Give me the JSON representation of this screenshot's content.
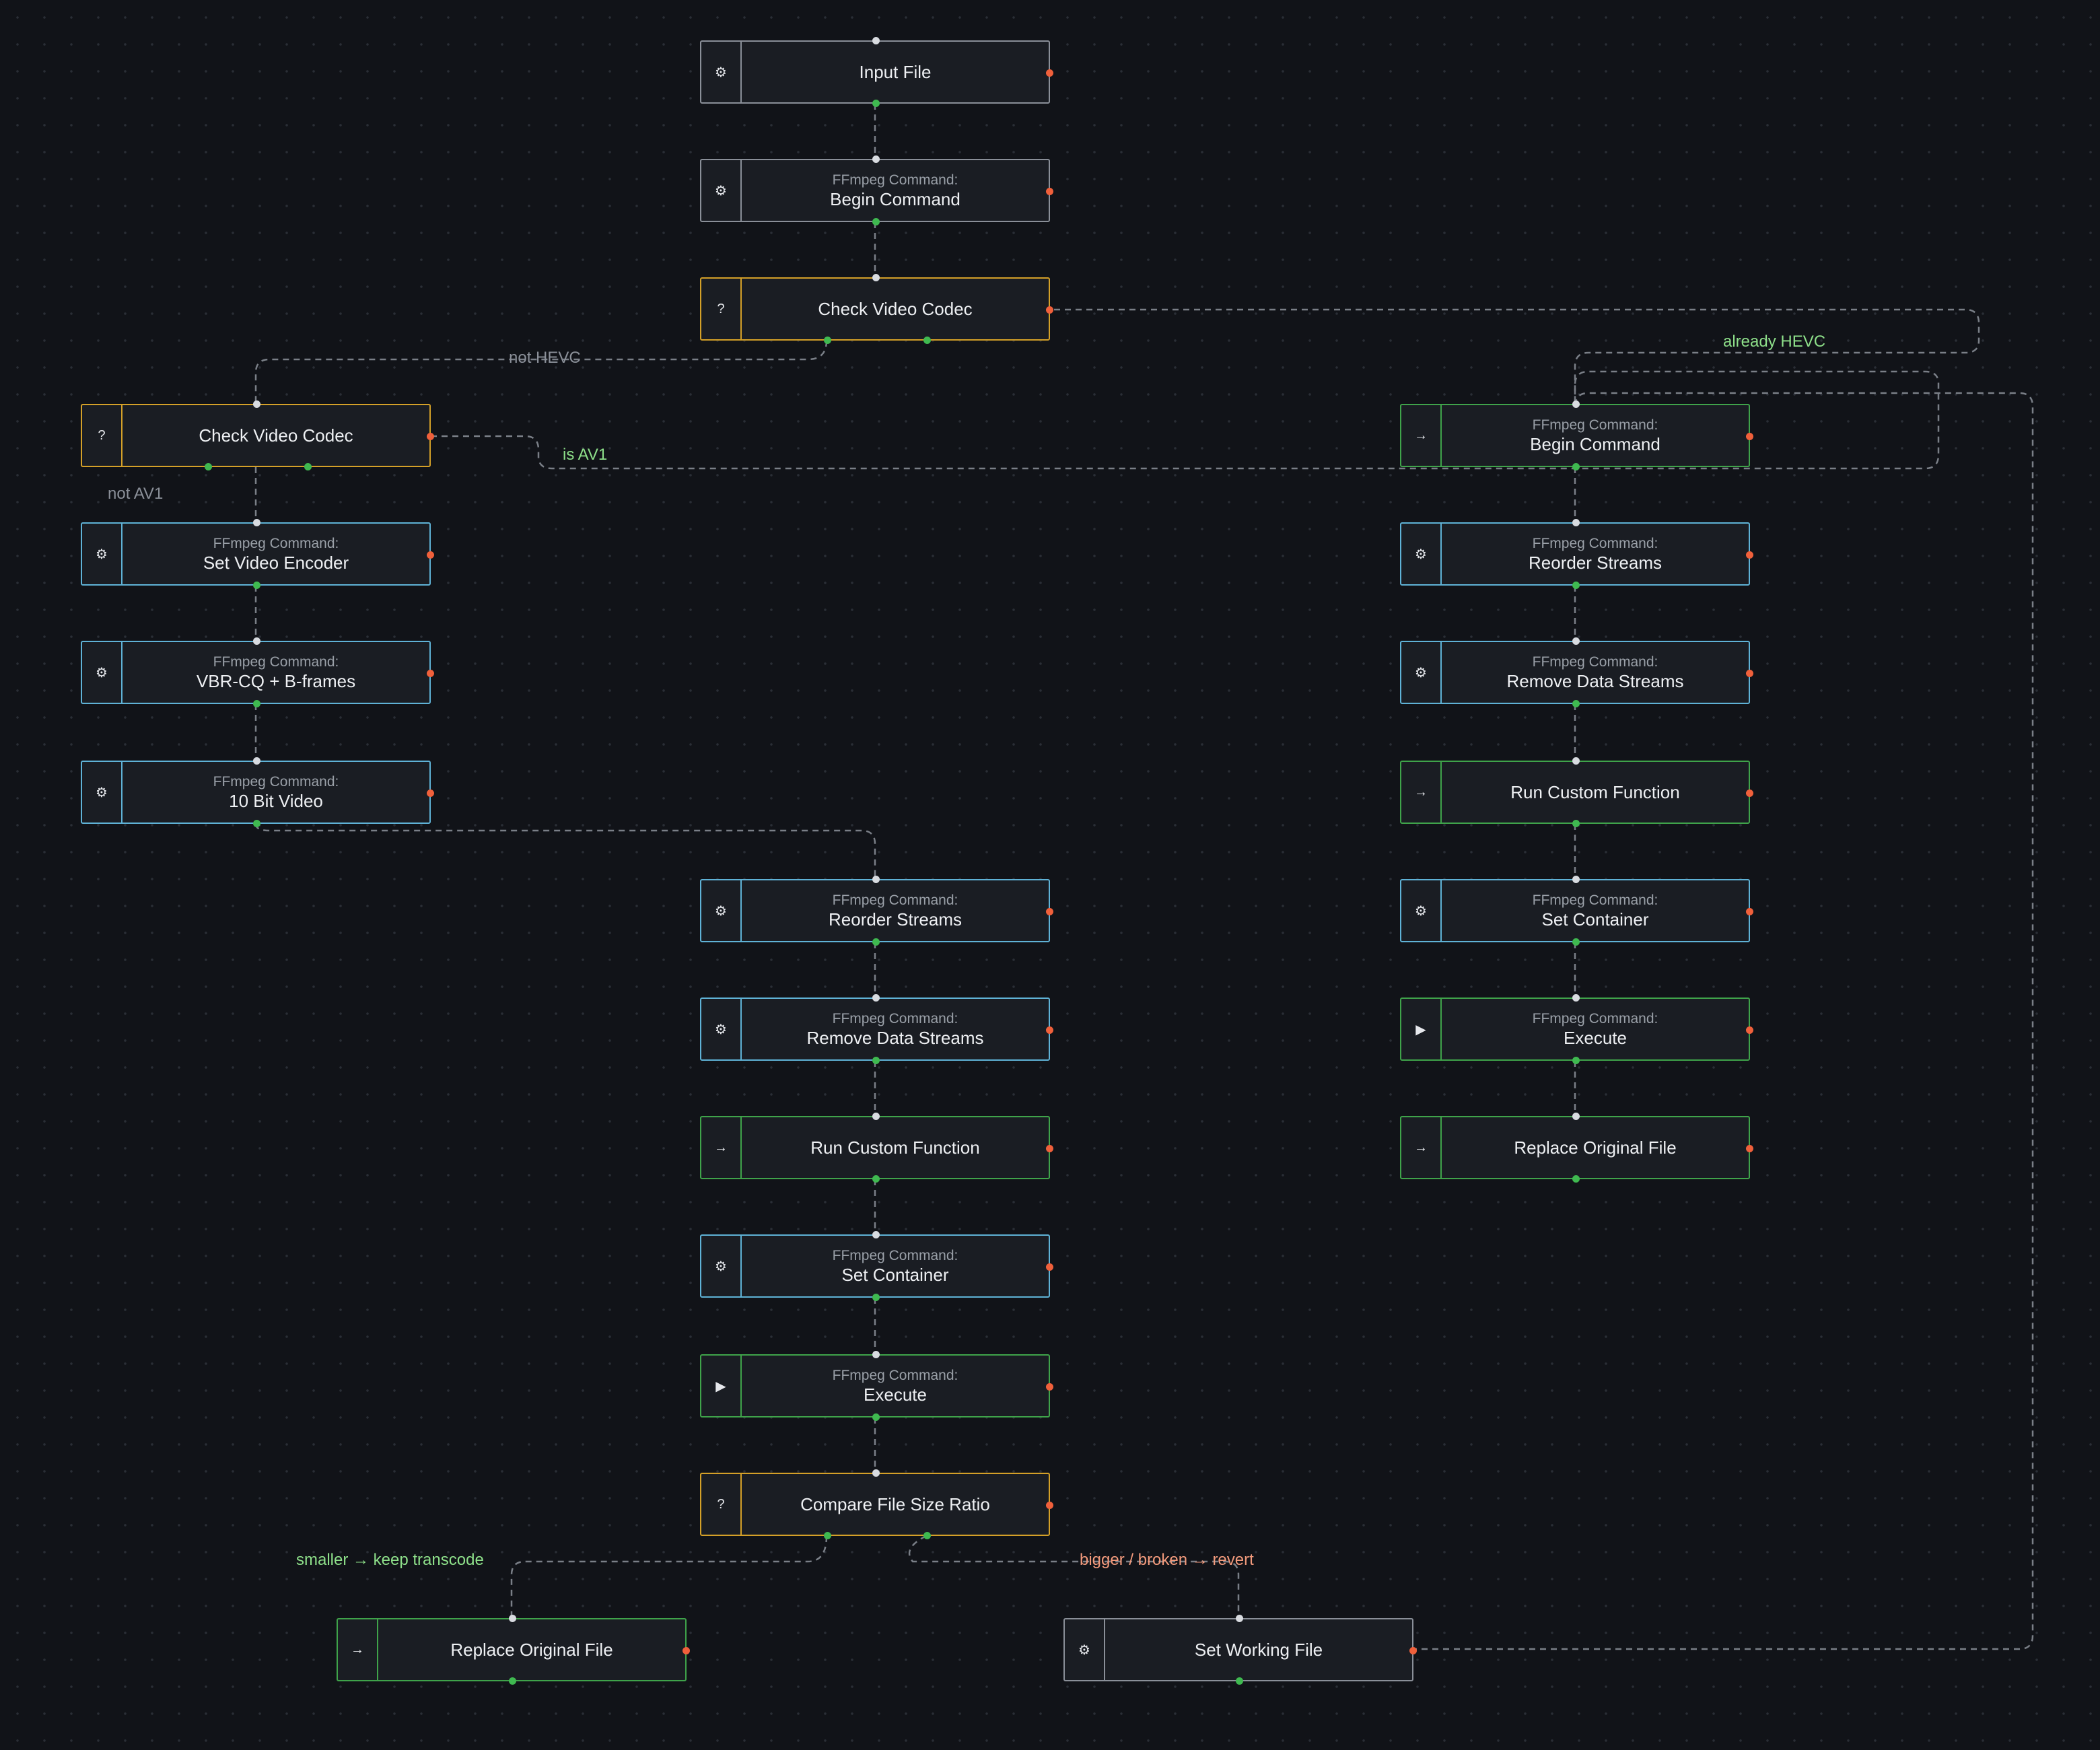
{
  "nodes": [
    {
      "id": "input",
      "icon": "gear-icon",
      "glyph": "⚙",
      "subtitle": "",
      "title": "Input File",
      "color": "gray"
    },
    {
      "id": "begin1",
      "icon": "gear-icon",
      "glyph": "⚙",
      "subtitle": "FFmpeg Command:",
      "title": "Begin Command",
      "color": "gray"
    },
    {
      "id": "check1",
      "icon": "question-icon",
      "glyph": "?",
      "subtitle": "",
      "title": "Check Video Codec",
      "color": "orange"
    },
    {
      "id": "check2",
      "icon": "question-icon",
      "glyph": "?",
      "subtitle": "",
      "title": "Check Video Codec",
      "color": "orange"
    },
    {
      "id": "encoder",
      "icon": "gear-icon",
      "glyph": "⚙",
      "subtitle": "FFmpeg Command:",
      "title": "Set Video Encoder",
      "color": "blue"
    },
    {
      "id": "vbr",
      "icon": "gear-icon",
      "glyph": "⚙",
      "subtitle": "FFmpeg Command:",
      "title": "VBR-CQ + B-frames",
      "color": "blue"
    },
    {
      "id": "tenbit",
      "icon": "gear-icon",
      "glyph": "⚙",
      "subtitle": "FFmpeg Command:",
      "title": "10 Bit Video",
      "color": "blue"
    },
    {
      "id": "m_reorder",
      "icon": "gear-icon",
      "glyph": "⚙",
      "subtitle": "FFmpeg Command:",
      "title": "Reorder Streams",
      "color": "blue"
    },
    {
      "id": "m_remove",
      "icon": "gear-icon",
      "glyph": "⚙",
      "subtitle": "FFmpeg Command:",
      "title": "Remove Data Streams",
      "color": "blue"
    },
    {
      "id": "m_custom",
      "icon": "arrow-right-icon",
      "glyph": "→",
      "subtitle": "",
      "title": "Run Custom Function",
      "color": "green"
    },
    {
      "id": "m_container",
      "icon": "gear-icon",
      "glyph": "⚙",
      "subtitle": "FFmpeg Command:",
      "title": "Set Container",
      "color": "blue"
    },
    {
      "id": "m_execute",
      "icon": "play-icon",
      "glyph": "▶",
      "subtitle": "FFmpeg Command:",
      "title": "Execute",
      "color": "green"
    },
    {
      "id": "compare",
      "icon": "question-icon",
      "glyph": "?",
      "subtitle": "",
      "title": "Compare File Size Ratio",
      "color": "orange"
    },
    {
      "id": "replace_l",
      "icon": "arrow-right-icon",
      "glyph": "→",
      "subtitle": "",
      "title": "Replace Original File",
      "color": "green"
    },
    {
      "id": "setwork",
      "icon": "gear-icon",
      "glyph": "⚙",
      "subtitle": "",
      "title": "Set Working File",
      "color": "gray"
    },
    {
      "id": "r_begin",
      "icon": "arrow-right-icon",
      "glyph": "→",
      "subtitle": "FFmpeg Command:",
      "title": "Begin Command",
      "color": "green"
    },
    {
      "id": "r_reorder",
      "icon": "gear-icon",
      "glyph": "⚙",
      "subtitle": "FFmpeg Command:",
      "title": "Reorder Streams",
      "color": "blue"
    },
    {
      "id": "r_remove",
      "icon": "gear-icon",
      "glyph": "⚙",
      "subtitle": "FFmpeg Command:",
      "title": "Remove Data Streams",
      "color": "blue"
    },
    {
      "id": "r_custom",
      "icon": "arrow-right-icon",
      "glyph": "→",
      "subtitle": "",
      "title": "Run Custom Function",
      "color": "green"
    },
    {
      "id": "r_container",
      "icon": "gear-icon",
      "glyph": "⚙",
      "subtitle": "FFmpeg Command:",
      "title": "Set Container",
      "color": "blue"
    },
    {
      "id": "r_execute",
      "icon": "play-icon",
      "glyph": "▶",
      "subtitle": "FFmpeg Command:",
      "title": "Execute",
      "color": "green"
    },
    {
      "id": "r_replace",
      "icon": "arrow-right-icon",
      "glyph": "→",
      "subtitle": "",
      "title": "Replace Original File",
      "color": "green"
    }
  ],
  "edge_labels": {
    "not_hevc": "not HEVC",
    "already_hevc": "already HEVC",
    "is_av1": "is AV1",
    "not_av1": "not AV1",
    "smaller_keep": "smaller → keep transcode",
    "bigger_revert": "bigger / broken → revert"
  },
  "colors": {
    "background": "#111318",
    "node_fill": "#1a1d23",
    "blue": "#5fb2d6",
    "green": "#3fa34a",
    "orange": "#d4a028",
    "gray": "#8a8f98",
    "in_port": "#d8dbe0",
    "out_port": "#3fb950",
    "error_port": "#f0603b",
    "wire": "#7a7f87"
  }
}
